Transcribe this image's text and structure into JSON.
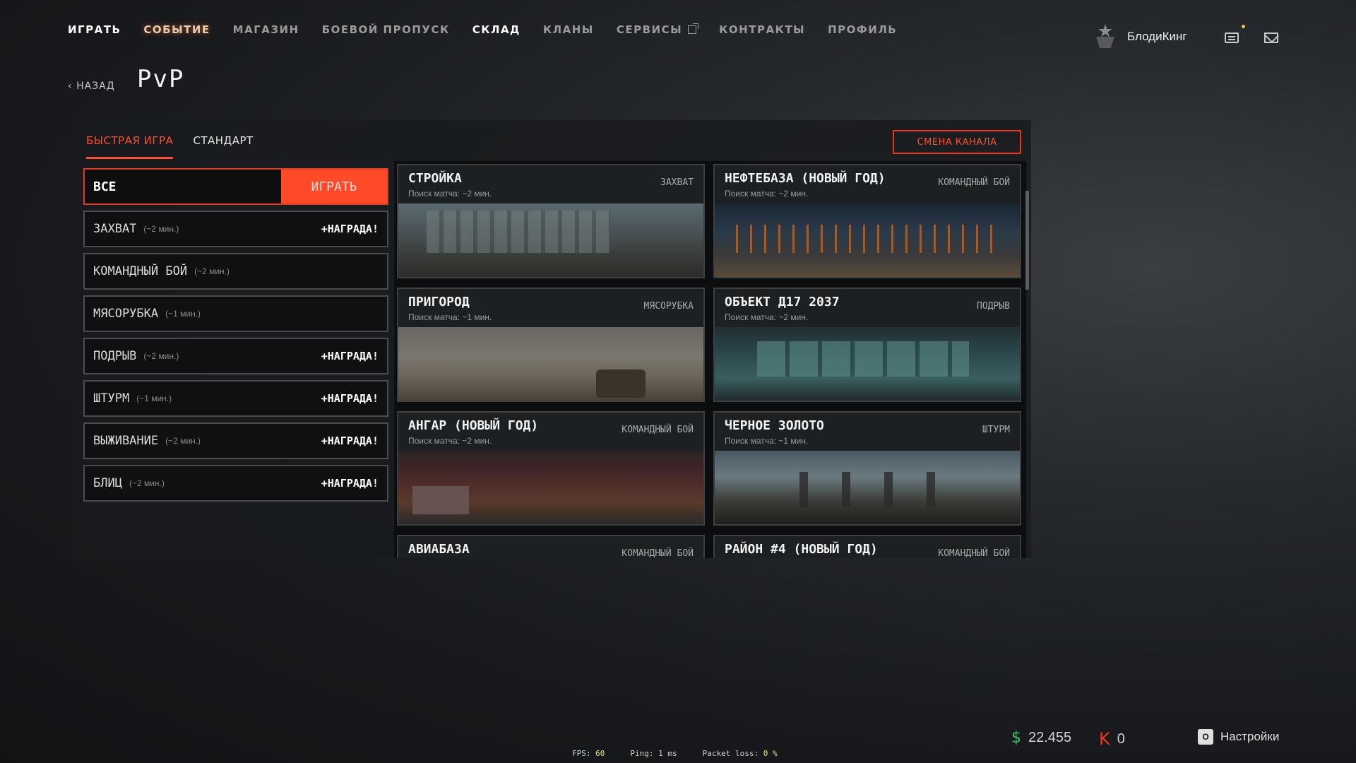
{
  "nav": {
    "items": [
      {
        "label": "ИГРАТЬ"
      },
      {
        "label": "СОБЫТИЕ"
      },
      {
        "label": "МАГАЗИН"
      },
      {
        "label": "БОЕВОЙ ПРОПУСК"
      },
      {
        "label": "СКЛАД"
      },
      {
        "label": "КЛАНЫ"
      },
      {
        "label": "СЕРВИСЫ"
      },
      {
        "label": "КОНТРАКТЫ"
      },
      {
        "label": "ПРОФИЛЬ"
      }
    ]
  },
  "user": {
    "name": "БлодиКинг",
    "icons": [
      "rank-icon",
      "chat-icon",
      "mail-icon"
    ]
  },
  "back_label": "НАЗАД",
  "page_title": "PvP",
  "tabs": [
    {
      "label": "БЫСТРАЯ ИГРА"
    },
    {
      "label": "СТАНДАРТ"
    }
  ],
  "channel_button": "СМЕНА КАНАЛА",
  "modes": {
    "all": {
      "label": "ВСЕ",
      "play_label": "ИГРАТЬ"
    },
    "list": [
      {
        "name": "ЗАХВАТ",
        "time": "(~2 мин.)",
        "reward": "+НАГРАДА!"
      },
      {
        "name": "КОМАНДНЫЙ БОЙ",
        "time": "(~2 мин.)",
        "reward": ""
      },
      {
        "name": "МЯСОРУБКА",
        "time": "(~1 мин.)",
        "reward": ""
      },
      {
        "name": "ПОДРЫВ",
        "time": "(~2 мин.)",
        "reward": "+НАГРАДА!"
      },
      {
        "name": "ШТУРМ",
        "time": "(~1 мин.)",
        "reward": "+НАГРАДА!"
      },
      {
        "name": "ВЫЖИВАНИЕ",
        "time": "(~2 мин.)",
        "reward": "+НАГРАДА!"
      },
      {
        "name": "БЛИЦ",
        "time": "(~2 мин.)",
        "reward": "+НАГРАДА!"
      }
    ]
  },
  "maps": [
    {
      "name": "СТРОЙКА",
      "search": "Поиск матча: ~2 мин.",
      "mode": "ЗАХВАТ"
    },
    {
      "name": "НЕФТЕБАЗА (НОВЫЙ ГОД)",
      "search": "Поиск матча: ~2 мин.",
      "mode": "КОМАНДНЫЙ БОЙ"
    },
    {
      "name": "ПРИГОРОД",
      "search": "Поиск матча: ~1 мин.",
      "mode": "МЯСОРУБКА"
    },
    {
      "name": "ОБЪЕКТ Д17 2037",
      "search": "Поиск матча: ~2 мин.",
      "mode": "ПОДРЫВ"
    },
    {
      "name": "АНГАР (НОВЫЙ ГОД)",
      "search": "Поиск матча: ~2 мин.",
      "mode": "КОМАНДНЫЙ БОЙ"
    },
    {
      "name": "ЧЕРНОЕ ЗОЛОТО",
      "search": "Поиск матча: ~1 мин.",
      "mode": "ШТУРМ"
    },
    {
      "name": "АВИАБАЗА",
      "search": "",
      "mode": "КОМАНДНЫЙ БОЙ"
    },
    {
      "name": "РАЙОН #4 (НОВЫЙ ГОД)",
      "search": "",
      "mode": "КОМАНДНЫЙ БОЙ"
    }
  ],
  "currency": {
    "money": "22.455",
    "credits": "0"
  },
  "settings_key": "O",
  "settings_label": "Настройки",
  "stats": {
    "fps_label": "FPS:",
    "fps": "60",
    "ping_label": "Ping:",
    "ping": "1 ms",
    "loss_label": "Packet loss:",
    "loss": "0",
    "loss_unit": "%"
  },
  "colors": {
    "accent": "#ff4a2a",
    "money": "#35c46b"
  }
}
